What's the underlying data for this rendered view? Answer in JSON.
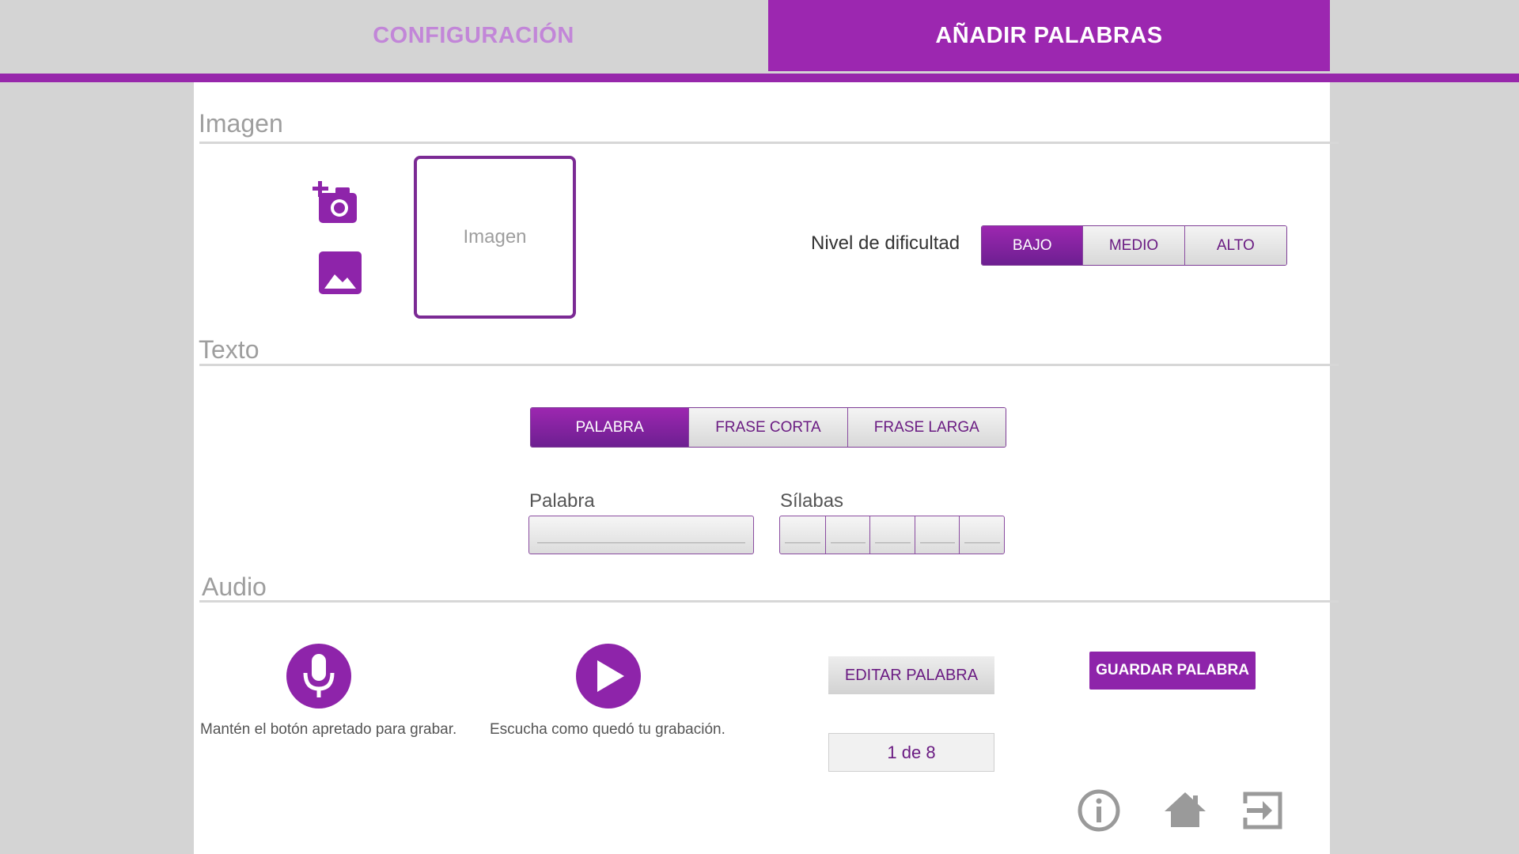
{
  "tabs": {
    "config": "CONFIGURACIÓN",
    "add_words": "AÑADIR PALABRAS"
  },
  "sections": {
    "image": "Imagen",
    "text": "Texto",
    "audio": "Audio"
  },
  "image": {
    "placeholder": "Imagen",
    "camera_icon": "camera-add-icon",
    "gallery_icon": "gallery-icon"
  },
  "difficulty": {
    "label": "Nivel de dificultad",
    "options": [
      "BAJO",
      "MEDIO",
      "ALTO"
    ],
    "selected": "BAJO"
  },
  "text_type": {
    "options": [
      "PALABRA",
      "FRASE CORTA",
      "FRASE LARGA"
    ],
    "selected": "PALABRA"
  },
  "fields": {
    "word_label": "Palabra",
    "word_value": "",
    "syllables_label": "Sílabas",
    "syllable_values": [
      "",
      "",
      "",
      "",
      ""
    ]
  },
  "audio": {
    "record_caption": "Mantén el botón apretado para grabar.",
    "play_caption": "Escucha como quedó tu grabación.",
    "edit_button": "EDITAR PALABRA",
    "save_button": "GUARDAR PALABRA",
    "counter": "1 de 8"
  },
  "footer": {
    "icons": [
      "info-icon",
      "home-icon",
      "exit-icon"
    ]
  },
  "colors": {
    "accent": "#9c27b0",
    "accent_dark": "#6d1f91",
    "inactive_tab_text": "#c286d8",
    "section_title": "#9e9e9e"
  }
}
